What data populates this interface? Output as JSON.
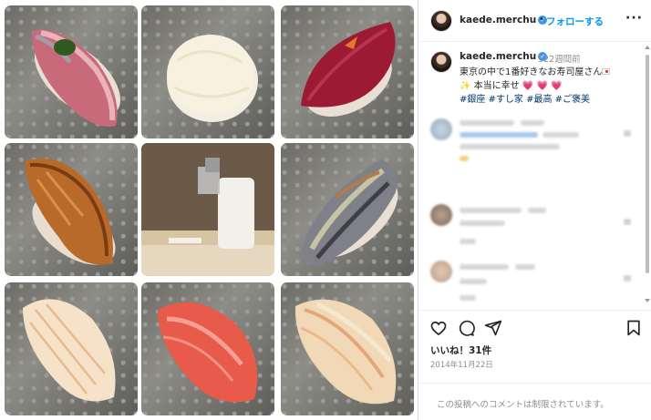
{
  "post": {
    "username": "kaede.merchu",
    "separator": "•",
    "follow_label": "フォローする",
    "more_label": "···"
  },
  "caption": {
    "username": "kaede.merchu",
    "weeks_ago": "522週間前",
    "line1": "東京の中で1番好きなお寿司屋さん",
    "line2_text": "✨ 本当に幸せ",
    "line2_hearts": "💗 💗 💗",
    "hashtags": "#銀座 #すし家 #最高 #ご褒美"
  },
  "photos": [
    {
      "label": "sushi-aji"
    },
    {
      "label": "sushi-hotate"
    },
    {
      "label": "sushi-akami"
    },
    {
      "label": "sushi-anago"
    },
    {
      "label": "chef-counter"
    },
    {
      "label": "sushi-kohada"
    },
    {
      "label": "sushi-ika"
    },
    {
      "label": "sushi-chutoro"
    },
    {
      "label": "sushi-kasugo"
    }
  ],
  "icons": {
    "like": "heart-icon",
    "comment": "comment-icon",
    "share": "share-icon",
    "save": "bookmark-icon"
  },
  "engagement": {
    "likes_label": "いいね！31件",
    "date": "2014年11月22日"
  },
  "comments_disabled": "この投稿へのコメントは制限されています。",
  "colors": {
    "link_blue": "#0095f6",
    "hashtag": "#00376b",
    "verified": "#3897f0",
    "muted": "#8e8e8e"
  }
}
